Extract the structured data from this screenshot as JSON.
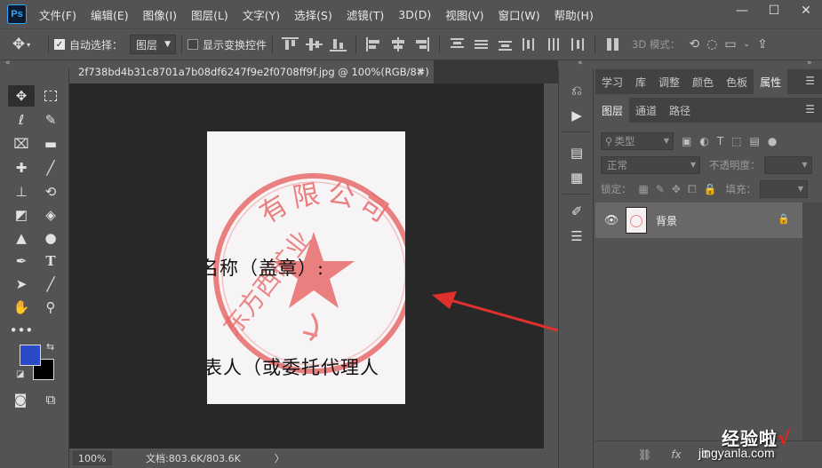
{
  "app": {
    "logo_text": "Ps",
    "menu": [
      "文件(F)",
      "编辑(E)",
      "图像(I)",
      "图层(L)",
      "文字(Y)",
      "选择(S)",
      "滤镜(T)",
      "3D(D)",
      "视图(V)",
      "窗口(W)",
      "帮助(H)"
    ],
    "window_controls": {
      "minimize": "—",
      "maximize": "☐",
      "close": "✕"
    }
  },
  "options_bar": {
    "auto_select_label": "自动选择：",
    "auto_select_target": "图层",
    "show_transform_label": "显示变换控件",
    "mode_3d_label": "3D 模式："
  },
  "document": {
    "tab_title": "2f738bd4b31c8701a7b08df6247f9e2f0708ff9f.jpg @ 100%(RGB/8#)",
    "close_icon": "×",
    "image_text_line1": "名称（盖章）:",
    "image_text_line2": "表人（或委托代理人",
    "seal_text": "有限公司",
    "seal_partial": "东方西矿业"
  },
  "status_bar": {
    "zoom": "100%",
    "doc_info": "文档:803.6K/803.6K",
    "arrow": "〉"
  },
  "panels": {
    "top_tabs": [
      "学习",
      "库",
      "调整",
      "颜色",
      "色板",
      "属性"
    ],
    "active_top_tab": "属性",
    "layer_tabs": [
      "图层",
      "通道",
      "路径"
    ],
    "active_layer_tab": "图层",
    "filter_label": "类型",
    "blend_mode": "正常",
    "opacity_label": "不透明度：",
    "lock_label": "锁定：",
    "fill_label": "填充：",
    "layers": [
      {
        "name": "背景",
        "locked": true,
        "visible": true
      }
    ]
  },
  "colors": {
    "foreground": "#2a4bc5",
    "background": "#000000",
    "accent": "#31a8ff",
    "annotation_arrow": "#e0302e",
    "seal_red": "#e86a6a"
  },
  "watermark": {
    "main": "经验啦",
    "check": "√",
    "sub": "jingyanla.com"
  }
}
